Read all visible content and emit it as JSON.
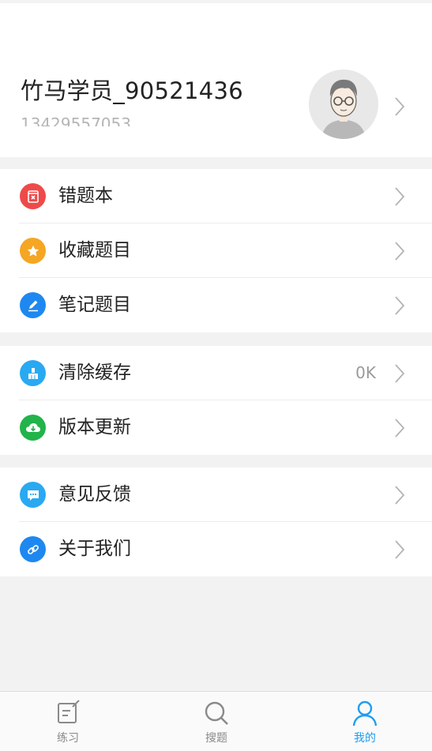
{
  "profile": {
    "username": "竹马学员_90521436",
    "phone": "13429557053"
  },
  "menu_groups": [
    {
      "items": [
        {
          "label": "错题本",
          "icon": "wrong-book-icon",
          "color": "#ef4a4a"
        },
        {
          "label": "收藏题目",
          "icon": "star-icon",
          "color": "#f5a623"
        },
        {
          "label": "笔记题目",
          "icon": "pencil-icon",
          "color": "#1e88f0"
        }
      ]
    },
    {
      "items": [
        {
          "label": "清除缓存",
          "icon": "broom-icon",
          "color": "#29a9f2",
          "value": "0K"
        },
        {
          "label": "版本更新",
          "icon": "cloud-download-icon",
          "color": "#22b34a"
        }
      ]
    },
    {
      "items": [
        {
          "label": "意见反馈",
          "icon": "chat-icon",
          "color": "#29a9f2"
        },
        {
          "label": "关于我们",
          "icon": "link-icon",
          "color": "#1e88f0"
        }
      ]
    }
  ],
  "tabs": [
    {
      "label": "练习",
      "icon": "edit-icon",
      "active": false
    },
    {
      "label": "搜题",
      "icon": "search-icon",
      "active": false
    },
    {
      "label": "我的",
      "icon": "user-icon",
      "active": true
    }
  ],
  "colors": {
    "accent": "#1e9ef0",
    "background": "#f2f2f2"
  }
}
